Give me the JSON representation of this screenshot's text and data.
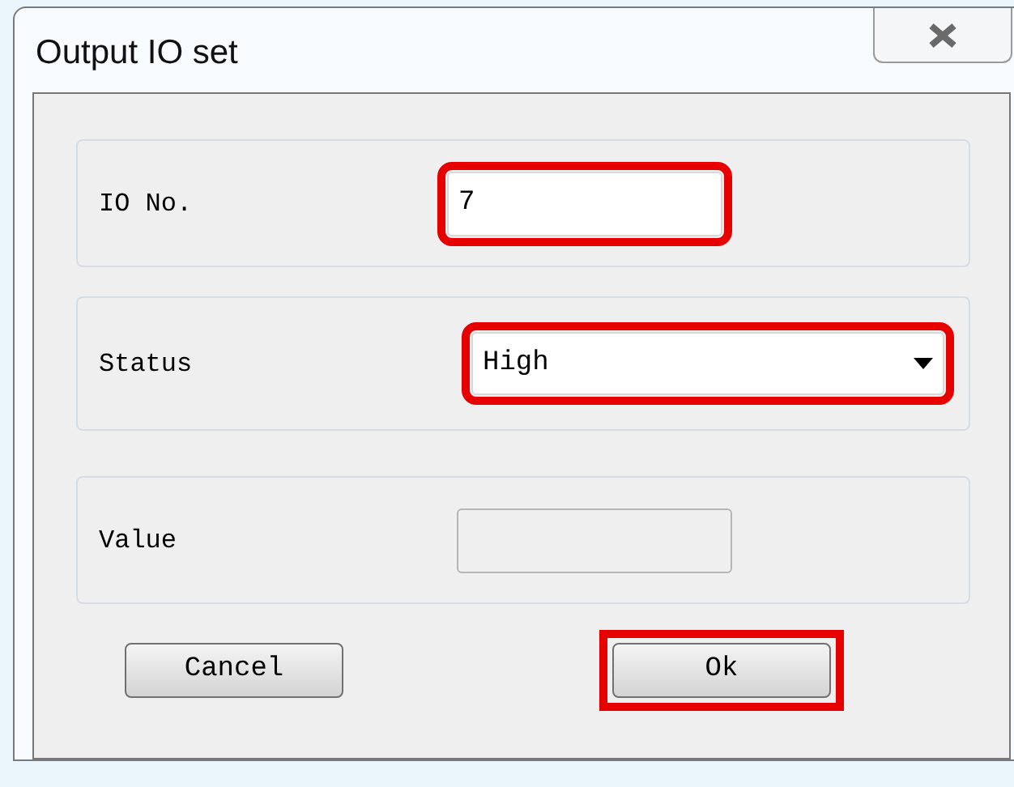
{
  "window": {
    "title": "Output IO set"
  },
  "fields": [
    {
      "kind": "text",
      "label": "IO No.",
      "value": "7",
      "disabled": false,
      "highlighted": true
    },
    {
      "kind": "dropdown",
      "label": "Status",
      "value": "High",
      "disabled": false,
      "highlighted": true
    },
    {
      "kind": "text",
      "label": "Value",
      "disabled": true,
      "highlighted": false
    }
  ],
  "buttons": [
    {
      "label": "Cancel",
      "highlighted": false
    },
    {
      "label": "Ok",
      "highlighted": true
    }
  ]
}
